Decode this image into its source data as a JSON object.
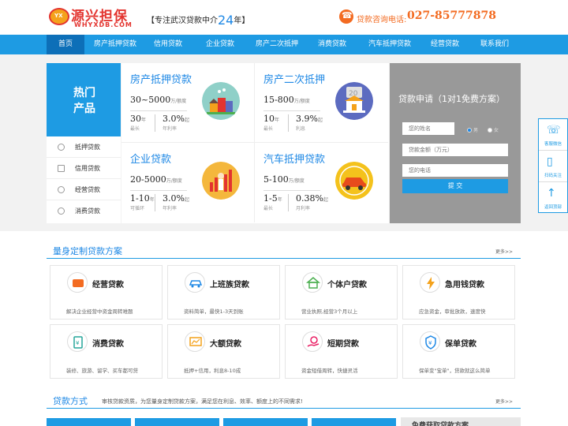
{
  "header": {
    "logo_cn": "源兴担保",
    "logo_en": "WHYXDB.COM",
    "logo_badge": "YX",
    "slogan_prefix": "【专注武汉贷款中介",
    "slogan_years": "24",
    "slogan_suffix": "年】",
    "hotline_label": "贷款咨询电话:",
    "hotline_number": "027-85777878"
  },
  "nav": [
    "首页",
    "房产抵押贷款",
    "信用贷款",
    "企业贷款",
    "房产二次抵押",
    "消费贷款",
    "汽车抵押贷款",
    "经营贷款",
    "联系我们"
  ],
  "hot": {
    "title": "热门产品",
    "side_menu": [
      "抵押贷款",
      "信用贷款",
      "经营贷款",
      "消费贷款"
    ]
  },
  "products": [
    {
      "title": "房产抵押贷款",
      "amount": "30~5000",
      "amount_unit": "万/额度",
      "s1_v": "30",
      "s1_u": "年",
      "s1_d": "最长",
      "s2_v": "3.0%",
      "s2_u": "起",
      "s2_d": "年利率"
    },
    {
      "title": "房产二次抵押",
      "amount": "15-800",
      "amount_unit": "万/额度",
      "s1_v": "10",
      "s1_u": "年",
      "s1_d": "最长",
      "s2_v": "3.9%",
      "s2_u": "起",
      "s2_d": "利息"
    },
    {
      "title": "企业贷款",
      "amount": "20-5000",
      "amount_unit": "万/额度",
      "s1_v": "1-10",
      "s1_u": "年",
      "s1_d": "可循环",
      "s2_v": "3.0%",
      "s2_u": "起",
      "s2_d": "年利率"
    },
    {
      "title": "汽车抵押贷款",
      "amount": "5-100",
      "amount_unit": "万/额度",
      "s1_v": "1-5",
      "s1_u": "年",
      "s1_d": "最长",
      "s2_v": "0.38%",
      "s2_u": "起",
      "s2_d": "月利率"
    }
  ],
  "apply": {
    "title": "贷款申请（1对1免费方案）",
    "name_placeholder": "您的姓名",
    "gender_male": "男",
    "gender_female": "女",
    "amount_placeholder": "贷款金额（万元）",
    "phone_placeholder": "您的电话",
    "submit": "提 交"
  },
  "float": [
    "客服微信",
    "扫码关注",
    "返回顶部"
  ],
  "section1": {
    "title": "量身定制贷款方案",
    "more": "更多>>",
    "cards": [
      {
        "title": "经营贷款",
        "desc": "解决企业经营中资金周转难题",
        "color": "#f36b21"
      },
      {
        "title": "上班族贷款",
        "desc": "资料简单，最快1-3天到账",
        "color": "#1e88e5"
      },
      {
        "title": "个体户贷款",
        "desc": "营业执照,经营3个月以上",
        "color": "#4caf50"
      },
      {
        "title": "急用钱贷款",
        "desc": "应急资金，审批放款，速度快",
        "color": "#f4a21c"
      },
      {
        "title": "消费贷款",
        "desc": "装修、旅游、留学、买车都可贷",
        "color": "#26a69a"
      },
      {
        "title": "大额贷款",
        "desc": "抵押+信用，利息8-10成",
        "color": "#f4a21c"
      },
      {
        "title": "短期贷款",
        "desc": "资金短借周转，快捷灵活",
        "color": "#e91e63"
      },
      {
        "title": "保单贷款",
        "desc": "保单变\"宝单\"，贷款就这么简单",
        "color": "#1e88e5"
      }
    ]
  },
  "section2": {
    "title": "贷款方式",
    "desc": "审核贷款资质，为您量身定制贷款方案，满足您在利息、效率、额度上的不同需求!",
    "more": "更多>>",
    "box_title": "免费获取贷款方案"
  }
}
